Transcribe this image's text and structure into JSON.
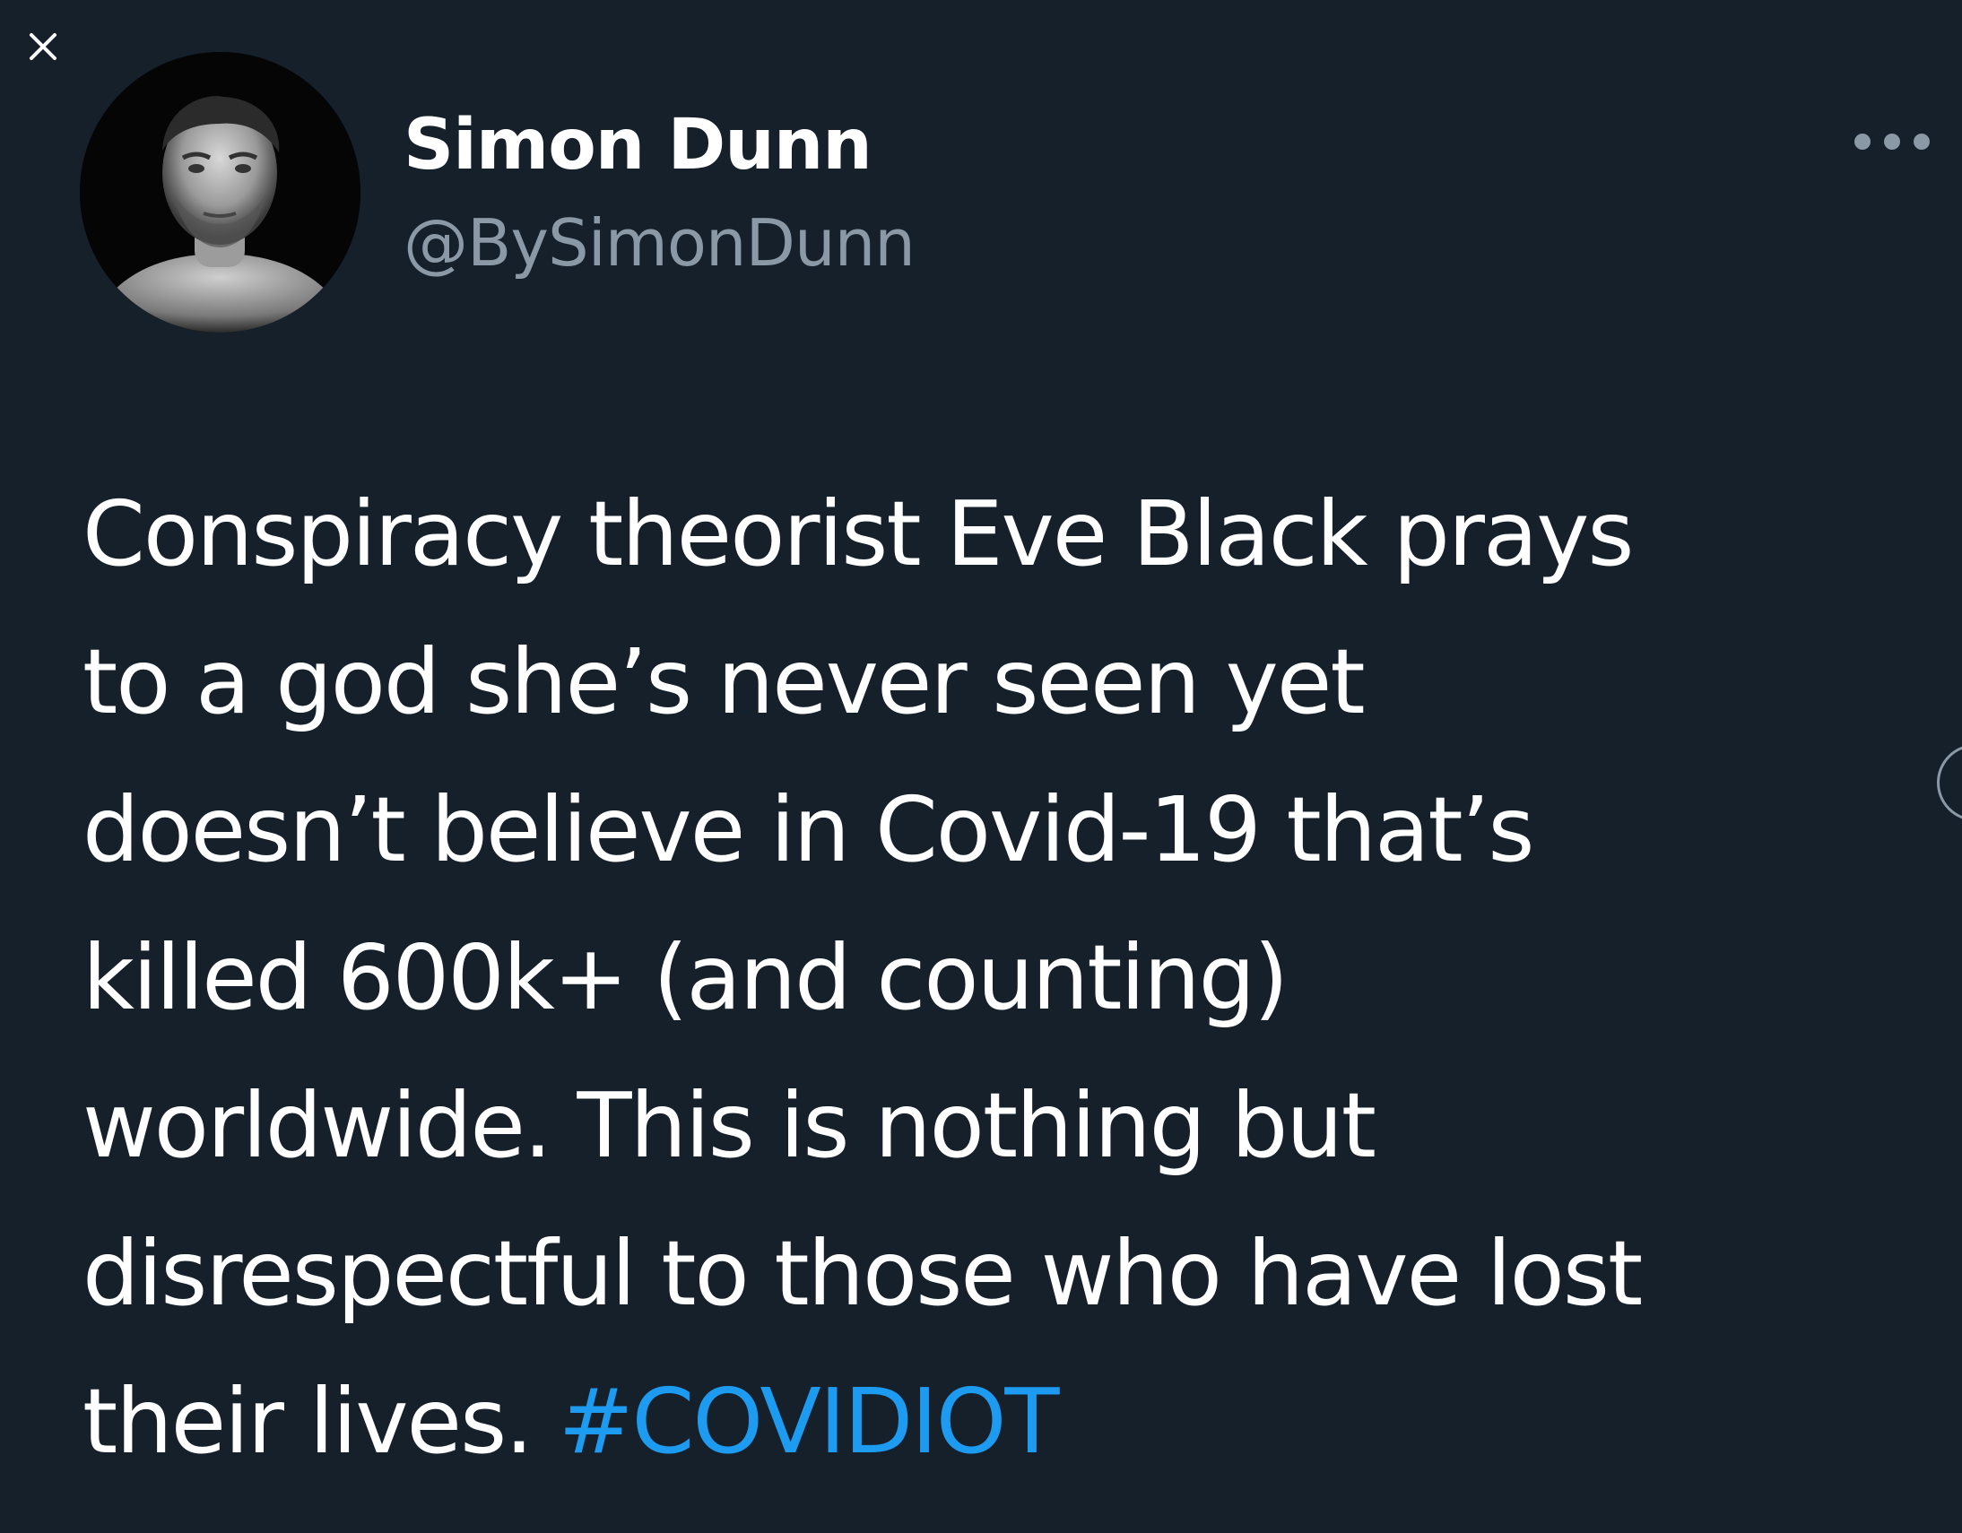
{
  "icons": {
    "close": "close-icon",
    "more": "more-horizontal-icon",
    "avatar": "profile-photo"
  },
  "tweet": {
    "author": {
      "name": "Simon Dunn",
      "handle": "@BySimonDunn"
    },
    "lines": [
      "Conspiracy theorist Eve Black prays",
      "to a god she’s never seen yet",
      "doesn’t believe in Covid-19 that’s",
      "killed 600k+ (and counting)",
      "worldwide. This is nothing but",
      "disrespectful to those who have lost"
    ],
    "last_line": {
      "text": "their lives. ",
      "hashtag": "#COVIDIOT"
    }
  },
  "colors": {
    "background": "#15202b",
    "text": "#ffffff",
    "secondary_text": "#8b98a5",
    "link": "#1d9bf0"
  }
}
